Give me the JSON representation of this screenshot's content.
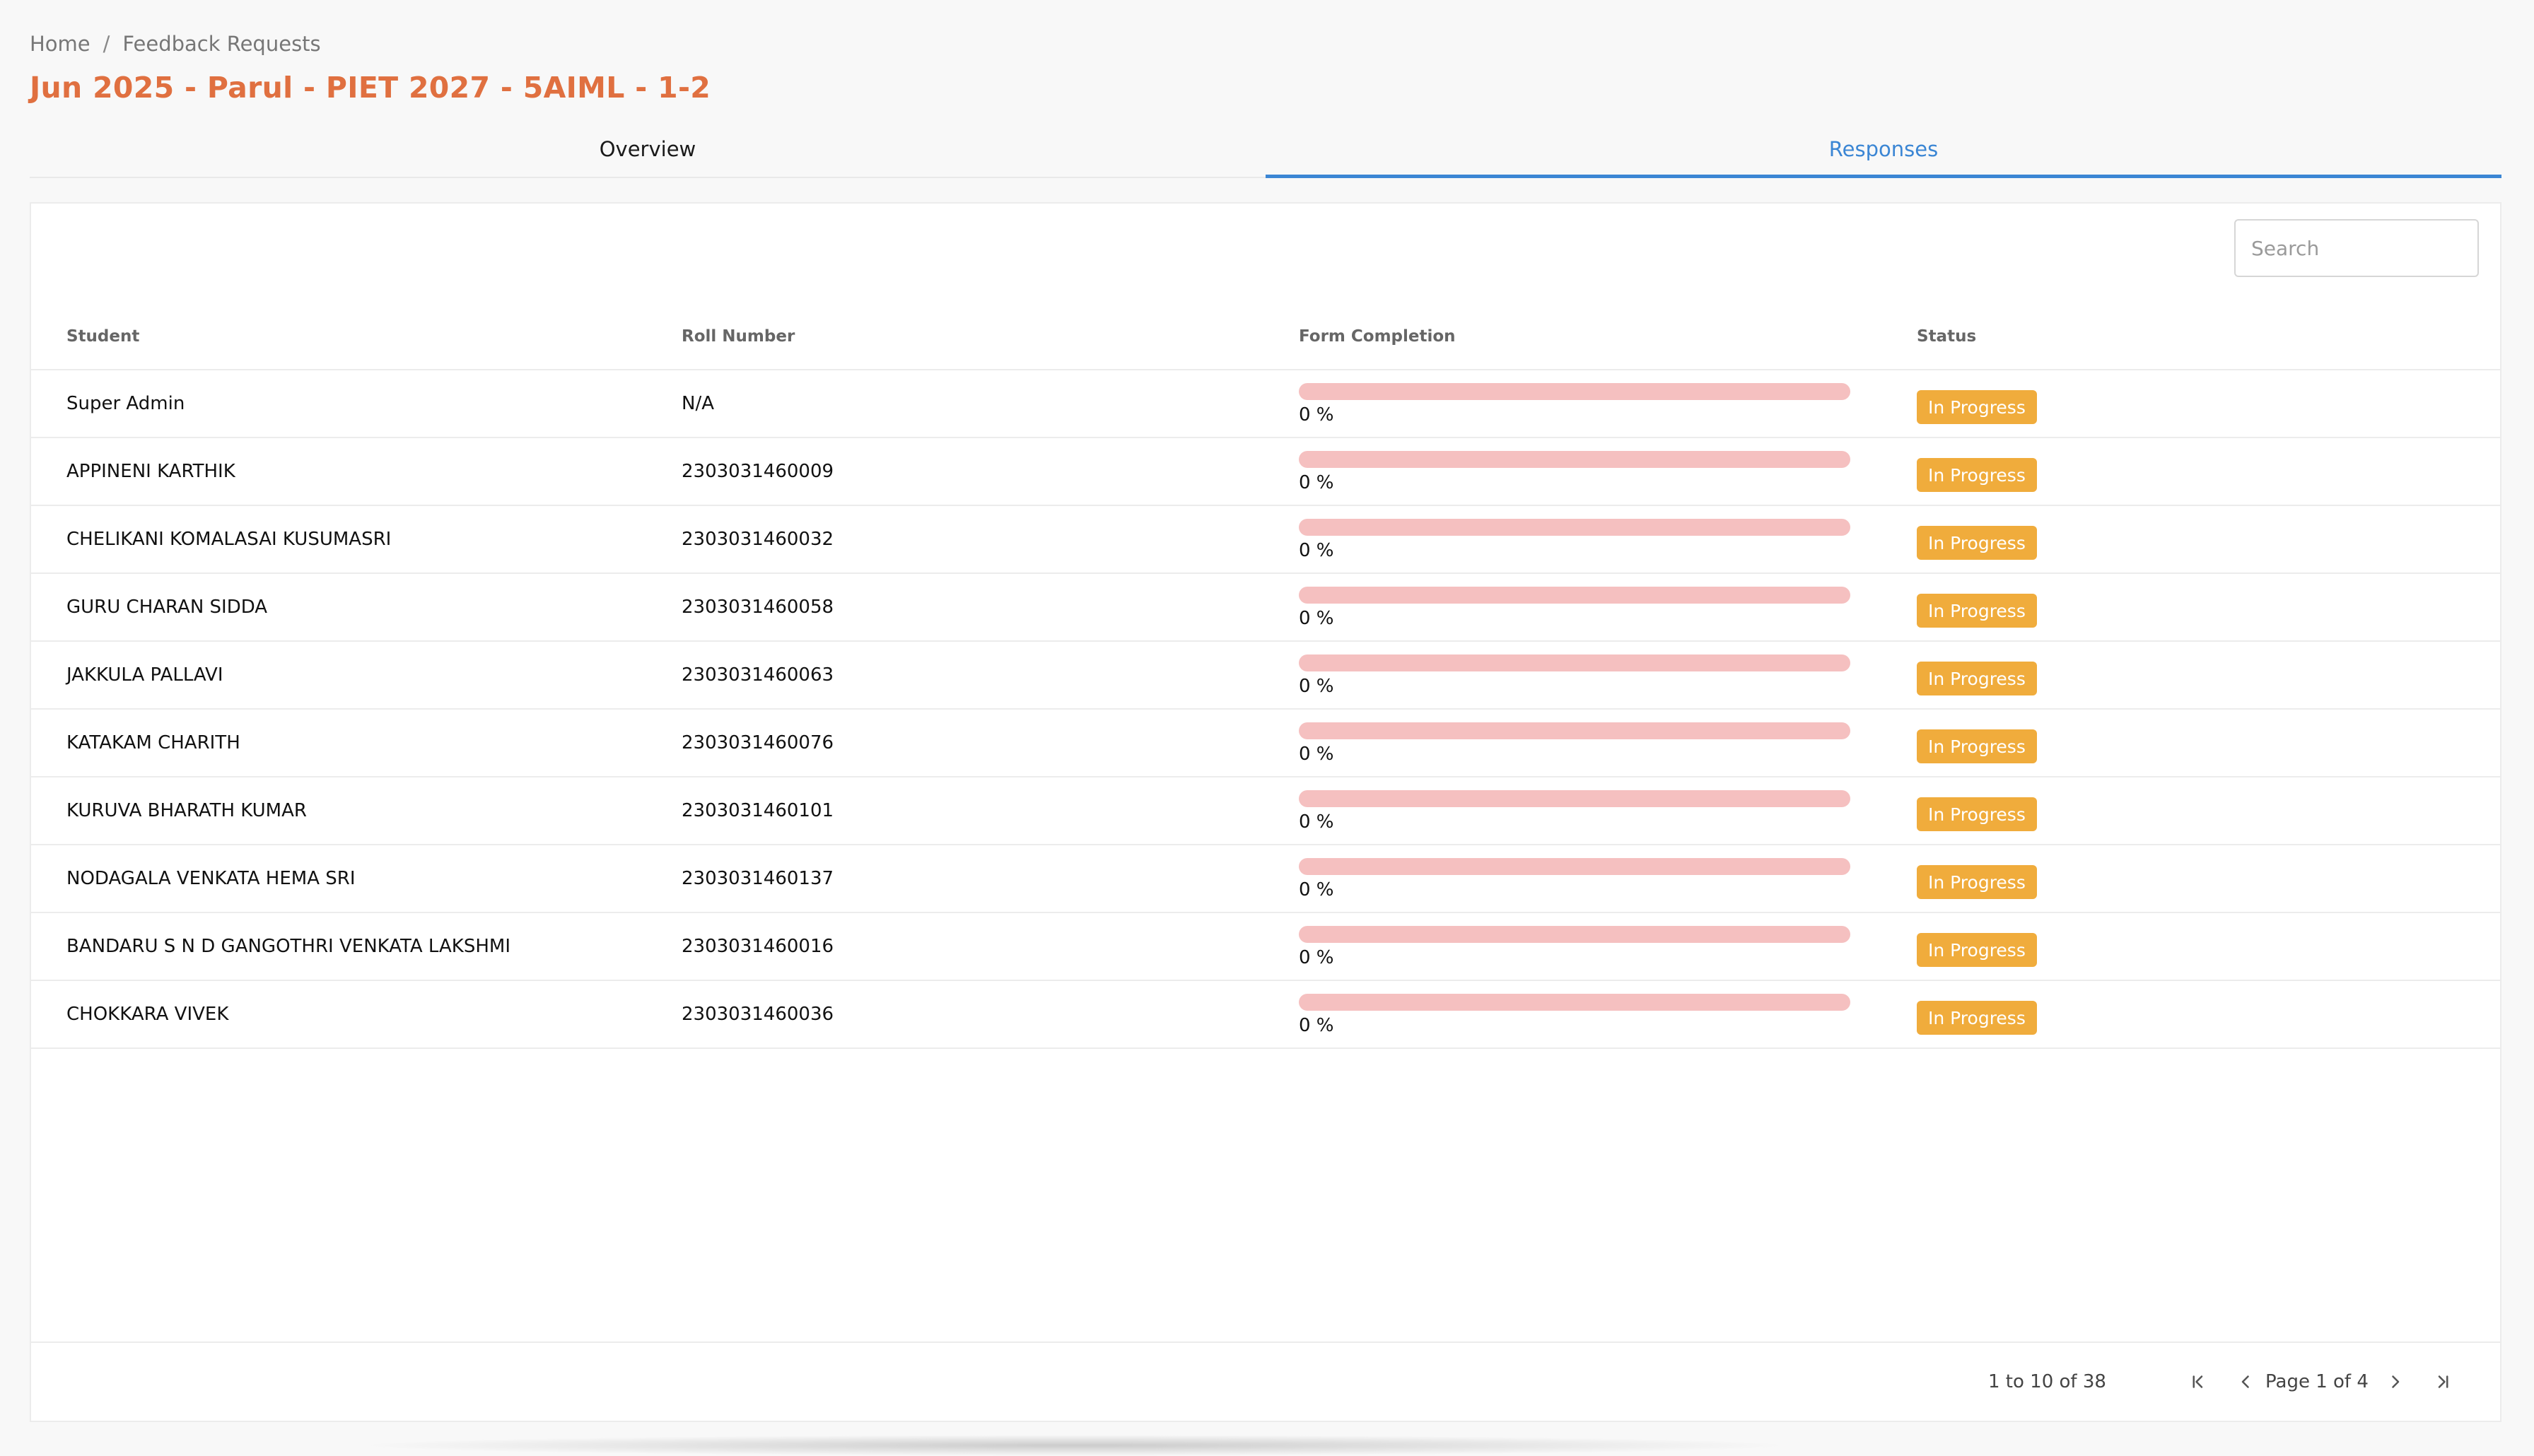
{
  "breadcrumb": {
    "home": "Home",
    "separator": "/",
    "current": "Feedback Requests"
  },
  "page_title": "Jun 2025 - Parul - PIET 2027 - 5AIML - 1-2",
  "tabs": [
    {
      "label": "Overview",
      "active": false
    },
    {
      "label": "Responses",
      "active": true
    }
  ],
  "search": {
    "placeholder": "Search",
    "value": ""
  },
  "table": {
    "headers": {
      "student": "Student",
      "roll_number": "Roll Number",
      "form_completion": "Form Completion",
      "status": "Status"
    },
    "rows": [
      {
        "student": "Super Admin",
        "roll_number": "N/A",
        "completion": 0,
        "completion_text": "0 %",
        "status": "In Progress"
      },
      {
        "student": "APPINENI KARTHIK",
        "roll_number": "2303031460009",
        "completion": 0,
        "completion_text": "0 %",
        "status": "In Progress"
      },
      {
        "student": "CHELIKANI KOMALASAI KUSUMASRI",
        "roll_number": "2303031460032",
        "completion": 0,
        "completion_text": "0 %",
        "status": "In Progress"
      },
      {
        "student": "GURU CHARAN SIDDA",
        "roll_number": "2303031460058",
        "completion": 0,
        "completion_text": "0 %",
        "status": "In Progress"
      },
      {
        "student": "JAKKULA PALLAVI",
        "roll_number": "2303031460063",
        "completion": 0,
        "completion_text": "0 %",
        "status": "In Progress"
      },
      {
        "student": "KATAKAM CHARITH",
        "roll_number": "2303031460076",
        "completion": 0,
        "completion_text": "0 %",
        "status": "In Progress"
      },
      {
        "student": "KURUVA BHARATH KUMAR",
        "roll_number": "2303031460101",
        "completion": 0,
        "completion_text": "0 %",
        "status": "In Progress"
      },
      {
        "student": "NODAGALA VENKATA HEMA SRI",
        "roll_number": "2303031460137",
        "completion": 0,
        "completion_text": "0 %",
        "status": "In Progress"
      },
      {
        "student": "BANDARU S N D GANGOTHRI VENKATA LAKSHMI",
        "roll_number": "2303031460016",
        "completion": 0,
        "completion_text": "0 %",
        "status": "In Progress"
      },
      {
        "student": "CHOKKARA VIVEK",
        "roll_number": "2303031460036",
        "completion": 0,
        "completion_text": "0 %",
        "status": "In Progress"
      }
    ]
  },
  "pagination": {
    "range_text": "1 to 10 of 38",
    "page_text": "Page 1 of 4",
    "icons": [
      "first-page-icon",
      "previous-page-icon",
      "next-page-icon",
      "last-page-icon"
    ]
  },
  "colors": {
    "title": "#e07040",
    "active_tab": "#3b86d4",
    "status_badge": "#f0ac3c",
    "progress_track": "#f5c0c0"
  }
}
